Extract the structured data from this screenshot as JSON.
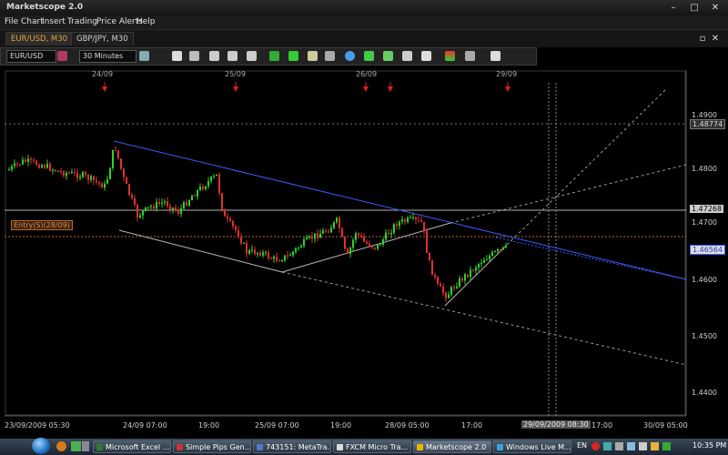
{
  "window": {
    "title": "Marketscope 2.0"
  },
  "menu": [
    "File",
    "Chart",
    "Insert",
    "Trading",
    "Price Alerts",
    "Help"
  ],
  "tabs": [
    "EUR/USD, M30",
    "GBP/JPY, M30"
  ],
  "toolbar": {
    "symbol": "EUR/USD",
    "timeframe": "30 Minutes"
  },
  "chart": {
    "top_dates": [
      "24/09",
      "25/09",
      "26/09",
      "29/09"
    ],
    "price_ticks": [
      "1.4900",
      "1.4800",
      "1.4700",
      "1.4600",
      "1.4500",
      "1.4400"
    ],
    "level_labels": {
      "high": "1.48774",
      "mid": "1.47268",
      "current": "1.46564"
    },
    "entry_label": "Entry(S)(28/09)",
    "time_labels": [
      "23/09/2009 05:30",
      "24/09 07:00",
      "19:00",
      "25/09 07:00",
      "19:00",
      "28/09 05:00",
      "17:00",
      "29/09/2009 08:30",
      "17:00",
      "30/09 05:00"
    ],
    "colors": {
      "bull": "#2bd42b",
      "bear": "#e03030",
      "trend": "#3d5bff",
      "entry": "#c0632a"
    }
  },
  "taskbar": {
    "items": [
      "Microsoft Excel ...",
      "Simple Pips Gen...",
      "743151: MetaTra...",
      "FXCM Micro Tra...",
      "Marketscope 2.0",
      "Windows Live M..."
    ],
    "lang": "EN",
    "clock": "10:35 PM"
  }
}
